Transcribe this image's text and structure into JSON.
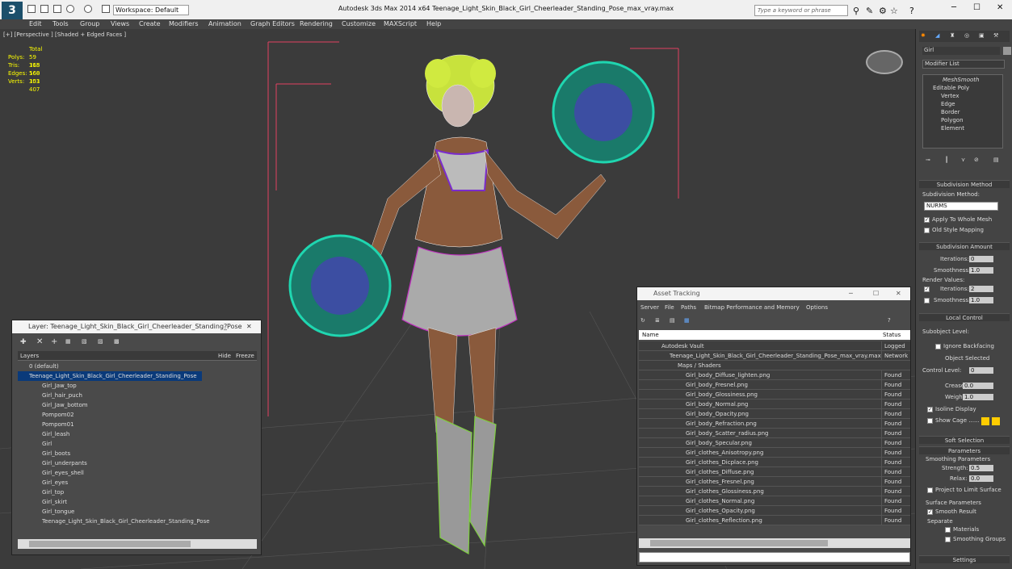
{
  "app": {
    "logo": "3",
    "title": "Autodesk 3ds Max  2014 x64     Teenage_Light_Skin_Black_Girl_Cheerleader_Standing_Pose_max_vray.max",
    "workspace": "Workspace: Default",
    "search_placeholder": "Type a keyword or phrase"
  },
  "menu": [
    "Edit",
    "Tools",
    "Group",
    "Views",
    "Create",
    "Modifiers",
    "Animation",
    "Graph Editors",
    "Rendering",
    "Customize",
    "MAXScript",
    "Help"
  ],
  "viewport": {
    "label": "[+] [Perspective ] [Shaded + Edged Faces ]",
    "stats": {
      "header": "Total",
      "rows": [
        {
          "k": "Polys:",
          "v": "59 365"
        },
        {
          "k": "Tris:",
          "v": "118 568"
        },
        {
          "k": "Edges:",
          "v": "160 351"
        },
        {
          "k": "Verts:",
          "v": "103 407"
        }
      ]
    }
  },
  "cmd": {
    "object_name": "Girl",
    "modifier_list": "Modifier List",
    "stack": [
      "MeshSmooth",
      "Editable Poly",
      "Vertex",
      "Edge",
      "Border",
      "Polygon",
      "Element"
    ],
    "sub_method_head": "Subdivision Method",
    "sub_method_label": "Subdivision Method:",
    "sub_method": "NURMS",
    "apply_whole": "Apply To Whole Mesh",
    "old_style": "Old Style Mapping",
    "sub_amount_head": "Subdivision Amount",
    "iterations": "Iterations:",
    "iter_val": "0",
    "smoothness": "Smoothness:",
    "smooth_val": "1.0",
    "render_values": "Render Values:",
    "r_iter": "Iterations:",
    "r_iter_val": "2",
    "r_smooth": "Smoothness:",
    "r_smooth_val": "1.0",
    "local_head": "Local Control",
    "sub_level": "Subobject Level:",
    "ignore_bf": "Ignore Backfacing",
    "obj_sel": "Object Selected",
    "ctrl_level": "Control Level:",
    "ctrl_val": "0",
    "crease": "Crease:",
    "crease_val": "0.0",
    "weight": "Weight:",
    "weight_val": "1.0",
    "isoline": "Isoline Display",
    "show_cage": "Show Cage ......",
    "soft_head": "Soft Selection",
    "params_head": "Parameters",
    "smooth_params": "Smoothing Parameters",
    "strength": "Strength:",
    "strength_val": "0.5",
    "relax": "Relax:",
    "relax_val": "0.0",
    "project": "Project to Limit Surface",
    "surface_params": "Surface Parameters",
    "smooth_result": "Smooth Result",
    "separate": "Separate",
    "materials": "Materials",
    "smoothing_groups": "Smoothing Groups",
    "settings_head": "Settings"
  },
  "layer": {
    "title": "Layer: Teenage_Light_Skin_Black_Girl_Cheerleader_Standing_Pose",
    "help": "?",
    "close": "✕",
    "col_layers": "Layers",
    "col_hide": "Hide",
    "col_freeze": "Freeze",
    "rows": [
      "0 (default)",
      "Teenage_Light_Skin_Black_Girl_Cheerleader_Standing_Pose",
      "Girl_Jaw_top",
      "Girl_hair_puch",
      "Girl_Jaw_bottom",
      "Pompom02",
      "Pompom01",
      "Girl_leash",
      "Girl",
      "Girl_boots",
      "Girl_underpants",
      "Girl_eyes_shell",
      "Girl_eyes",
      "Girl_top",
      "Girl_skirt",
      "Girl_tongue",
      "Teenage_Light_Skin_Black_Girl_Cheerleader_Standing_Pose"
    ]
  },
  "asset": {
    "title": "Asset Tracking",
    "menu": [
      "Server",
      "File",
      "Paths",
      "Bitmap Performance and Memory",
      "Options"
    ],
    "col_name": "Name",
    "col_status": "Status",
    "rows": [
      {
        "n": "Autodesk Vault",
        "s": "Logged O"
      },
      {
        "n": "Teenage_Light_Skin_Black_Girl_Cheerleader_Standing_Pose_max_vray.max",
        "s": "Network"
      },
      {
        "n": "Maps / Shaders",
        "s": ""
      },
      {
        "n": "Girl_body_Diffuse_lighten.png",
        "s": "Found"
      },
      {
        "n": "Girl_body_Fresnel.png",
        "s": "Found"
      },
      {
        "n": "Girl_body_Glossiness.png",
        "s": "Found"
      },
      {
        "n": "Girl_body_Normal.png",
        "s": "Found"
      },
      {
        "n": "Girl_body_Opacity.png",
        "s": "Found"
      },
      {
        "n": "Girl_body_Refraction.png",
        "s": "Found"
      },
      {
        "n": "Girl_body_Scatter_radius.png",
        "s": "Found"
      },
      {
        "n": "Girl_body_Specular.png",
        "s": "Found"
      },
      {
        "n": "Girl_clothes_Anisotropy.png",
        "s": "Found"
      },
      {
        "n": "Girl_clothes_Dicplace.png",
        "s": "Found"
      },
      {
        "n": "Girl_clothes_Diffuse.png",
        "s": "Found"
      },
      {
        "n": "Girl_clothes_Fresnel.png",
        "s": "Found"
      },
      {
        "n": "Girl_clothes_Glossiness.png",
        "s": "Found"
      },
      {
        "n": "Girl_clothes_Normal.png",
        "s": "Found"
      },
      {
        "n": "Girl_clothes_Opacity.png",
        "s": "Found"
      },
      {
        "n": "Girl_clothes_Reflection.png",
        "s": "Found"
      }
    ]
  }
}
